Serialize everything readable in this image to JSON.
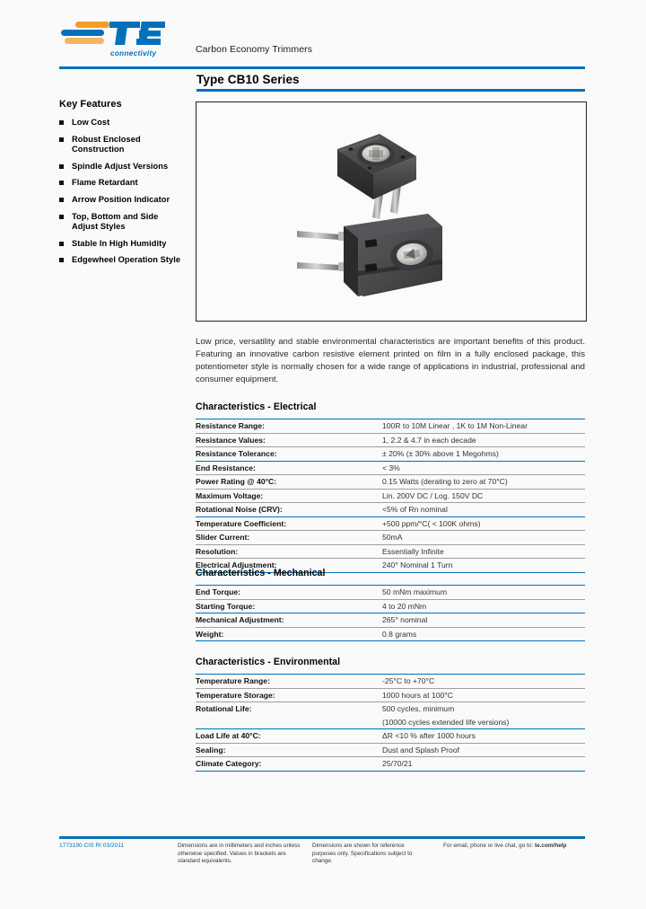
{
  "header": {
    "logo_alt": "TE connectivity",
    "logo_wordmark": "TE",
    "logo_subtext": "connectivity",
    "tagline": "Carbon Economy Trimmers",
    "accent_color": "#0071b9"
  },
  "series": {
    "title": "Type CB10 Series"
  },
  "key_features": {
    "title": "Key Features",
    "items": [
      "Low Cost",
      "Robust Enclosed Construction",
      "Spindle Adjust Versions",
      "Flame Retardant",
      "Arrow Position Indicator",
      "Top, Bottom and Side Adjust Styles",
      "Stable In High Humidity",
      "Edgewheel Operation Style"
    ]
  },
  "product_image": {
    "alt": "Two CB10 series carbon trimmer potentiometers, dark grey enclosed packages with metal adjustment screw and solder pins"
  },
  "description": {
    "text": "Low price, versatility and stable environmental characteristics are important benefits of this product.  Featuring an innovative carbon resistive element printed on film in a fully enclosed package, this potentiometer style is normally chosen for a wide range of applications in industrial, professional and consumer equipment."
  },
  "sections": {
    "electrical": {
      "title": "Characteristics - Electrical",
      "rows": [
        {
          "key": "Resistance Range:",
          "value": "100R to 10M Linear , 1K to 1M Non-Linear",
          "rule": "blue"
        },
        {
          "key": "Resistance Values:",
          "value": "1, 2.2 & 4.7 in each decade",
          "rule": "gray"
        },
        {
          "key": "Resistance Tolerance:",
          "value": "± 20% (± 30% above 1 Megohms)",
          "rule": "gray"
        },
        {
          "key": "End Resistance:",
          "value": "< 3%",
          "rule": "blue"
        },
        {
          "key": "Power Rating @ 40°C:",
          "value": "0.15 Watts (derating to zero at 70°C)",
          "rule": "gray"
        },
        {
          "key": "Maximum Voltage:",
          "value": "Lin. 200V DC / Log. 150V DC",
          "rule": "gray"
        },
        {
          "key": "Rotational Noise (CRV):",
          "value": "<5% of Rn nominal",
          "rule": "gray"
        },
        {
          "key": "Temperature Coefficient:",
          "value": "+500 ppm/°C( < 100K ohms)",
          "rule": "blue"
        },
        {
          "key": "Slider Current:",
          "value": "50mA",
          "rule": "gray"
        },
        {
          "key": "Resolution:",
          "value": "Essentially Infinite",
          "rule": "gray"
        },
        {
          "key": "Electrical Adjustment:",
          "value": "240° Nominal 1 Turn",
          "rule": "gray"
        }
      ],
      "bottom_rule": "blue"
    },
    "mechanical": {
      "title": "Characteristics - Mechanical",
      "rows": [
        {
          "key": "End Torque:",
          "value": "50 mNm maximum",
          "rule": "blue"
        },
        {
          "key": "Starting Torque:",
          "value": "4 to 20 mNm",
          "rule": "gray"
        },
        {
          "key": "Mechanical Adjustment:",
          "value": "265° nominal",
          "rule": "blue"
        },
        {
          "key": "Weight:",
          "value": "0.8 grams",
          "rule": "gray"
        }
      ],
      "bottom_rule": "blue"
    },
    "environmental": {
      "title": "Characteristics - Environmental",
      "rows": [
        {
          "key": "Temperature Range:",
          "value": "-25°C to +70°C",
          "rule": "blue"
        },
        {
          "key": "Temperature Storage:",
          "value": "1000 hours at 100°C",
          "rule": "gray"
        },
        {
          "key": "Rotational Life:",
          "value": "500 cycles, minimum",
          "rule": "gray"
        },
        {
          "key": "",
          "value": "(10000 cycles extended life versions)",
          "rule": "none"
        },
        {
          "key": "Load Life at 40°C:",
          "value": "ΔR <10 % after 1000 hours",
          "rule": "blue"
        },
        {
          "key": "Sealing:",
          "value": "Dust and Splash Proof",
          "rule": "gray"
        },
        {
          "key": "Climate Category:",
          "value": "25/70/21",
          "rule": "gray"
        }
      ],
      "bottom_rule": "blue"
    }
  },
  "footer": {
    "doc_number": "1773190 CIS  RI 03/2011",
    "note_dimensions": "Dimensions are in millimeters and inches unless otherwise specified. Values in brackets are standard equivalents.",
    "note_reference": "Dimensions are shown for reference purposes only. Specifications subject to change.",
    "contact_prefix": "For email, phone or live chat, go to: ",
    "contact_link": "te.com/help"
  }
}
